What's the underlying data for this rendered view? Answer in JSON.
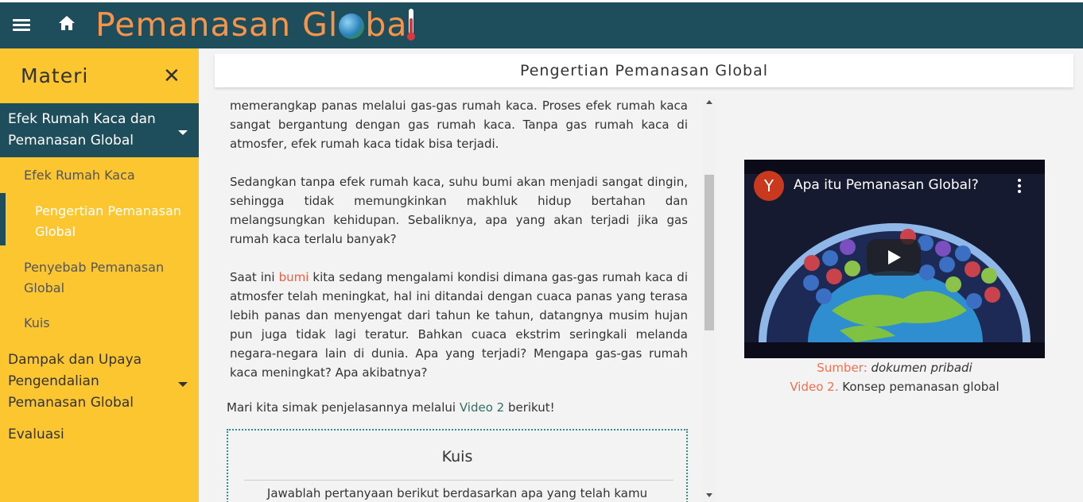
{
  "header": {
    "brand_prefix": "Pemanasan Gl",
    "brand_suffix": "ba",
    "menu_icon": "hamburger-icon",
    "home_icon": "home-icon"
  },
  "sidebar": {
    "title": "Materi",
    "close_icon": "close-icon",
    "sections": [
      {
        "label": "Efek Rumah Kaca dan Pemanasan Global",
        "active": true
      },
      {
        "label": "Dampak dan Upaya Pengendalian Pemanasan Global",
        "active": false
      },
      {
        "label": "Evaluasi",
        "active": false
      }
    ],
    "sub_items": [
      {
        "label": "Efek Rumah Kaca"
      },
      {
        "label": "Pengertian Pemanasan Global",
        "current": true
      },
      {
        "label": "Penyebab Pemanasan Global"
      },
      {
        "label": "Kuis"
      }
    ]
  },
  "main": {
    "page_title": "Pengertian Pemanasan Global",
    "para1": "memerangkap panas melalui gas-gas rumah kaca. Proses efek rumah kaca sangat bergantung dengan gas rumah kaca. Tanpa gas rumah kaca di atmosfer, efek rumah kaca tidak bisa terjadi.",
    "para2": "Sedangkan tanpa efek rumah kaca, suhu bumi akan menjadi sangat dingin, sehingga tidak memungkinkan makhluk hidup bertahan dan melangsungkan kehidupan. Sebaliknya, apa yang akan terjadi jika gas rumah kaca terlalu banyak?",
    "para3_start": "Saat ini ",
    "para3_highlight": "bumi",
    "para3_end": " kita sedang mengalami kondisi dimana gas-gas rumah kaca di atmosfer telah meningkat, hal ini ditandai dengan cuaca panas yang terasa lebih panas dan menyengat dari tahun ke tahun, datangnya musim hujan pun juga tidak lagi teratur. Bahkan cuaca ekstrim seringkali melanda negara-negara lain di dunia. Apa yang terjadi? Mengapa gas-gas rumah kaca meningkat? Apa akibatnya?",
    "para4_start": "Mari kita simak penjelasannya melalui ",
    "para4_link": "Video 2",
    "para4_end": " berikut!",
    "quiz_title": "Kuis",
    "quiz_text": "Jawablah pertanyaan berikut berdasarkan apa yang telah kamu"
  },
  "video": {
    "channel_initial": "Y",
    "title": "Apa itu Pemanasan Global?",
    "source_label": "Sumber:",
    "source_value": "dokumen pribadi",
    "caption_label": "Video 2.",
    "caption_value": "Konsep pemanasan global"
  },
  "scrollbar": {
    "position": 0.2
  },
  "colors": {
    "topbar": "#1e4d5c",
    "brand": "#f5944a",
    "sidebar": "#fcc630",
    "highlight": "#ef5d3f"
  }
}
